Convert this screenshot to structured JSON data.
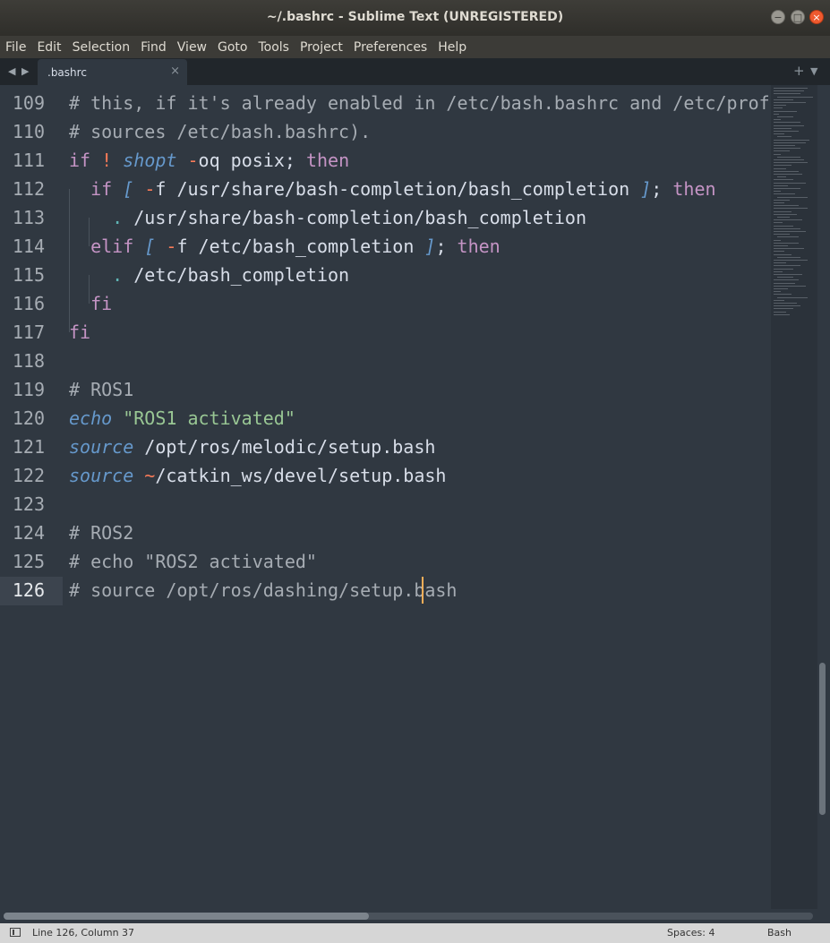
{
  "window": {
    "title": "~/.bashrc - Sublime Text (UNREGISTERED)",
    "buttons": {
      "minimize": "−",
      "maximize": "□",
      "close": "×"
    }
  },
  "menu": [
    "File",
    "Edit",
    "Selection",
    "Find",
    "View",
    "Goto",
    "Tools",
    "Project",
    "Preferences",
    "Help"
  ],
  "tabs": {
    "prev_icon": "◀",
    "next_icon": "▶",
    "active": {
      "label": ".bashrc",
      "close": "×"
    },
    "new_tab": "+",
    "tab_menu": "▼"
  },
  "editor": {
    "line_numbers": [
      "109",
      "110",
      "111",
      "112",
      "113",
      "114",
      "115",
      "116",
      "117",
      "118",
      "119",
      "120",
      "121",
      "122",
      "123",
      "124",
      "125",
      "126"
    ],
    "current_line": "126",
    "lines": [
      {
        "tokens": [
          {
            "t": "# this, if it's already enabled in /etc/bash.bashrc and /etc/profile",
            "c": "cm"
          }
        ]
      },
      {
        "tokens": [
          {
            "t": "# sources /etc/bash.bashrc).",
            "c": "cm"
          }
        ]
      },
      {
        "tokens": [
          {
            "t": "if",
            "c": "kw"
          },
          {
            "t": " ",
            "c": "pl"
          },
          {
            "t": "!",
            "c": "op"
          },
          {
            "t": " ",
            "c": "pl"
          },
          {
            "t": "shopt",
            "c": "fn"
          },
          {
            "t": " ",
            "c": "pl"
          },
          {
            "t": "-",
            "c": "op"
          },
          {
            "t": "oq posix; ",
            "c": "pl"
          },
          {
            "t": "then",
            "c": "kw"
          }
        ]
      },
      {
        "tokens": [
          {
            "t": "  ",
            "c": "pl"
          },
          {
            "t": "if",
            "c": "kw"
          },
          {
            "t": " ",
            "c": "pl"
          },
          {
            "t": "[",
            "c": "fn"
          },
          {
            "t": " ",
            "c": "pl"
          },
          {
            "t": "-",
            "c": "op"
          },
          {
            "t": "f /usr/share/bash-completion/bash_completion ",
            "c": "pl"
          },
          {
            "t": "]",
            "c": "fn"
          },
          {
            "t": "; ",
            "c": "pl"
          },
          {
            "t": "then",
            "c": "kw"
          }
        ]
      },
      {
        "tokens": [
          {
            "t": "    ",
            "c": "pl"
          },
          {
            "t": ".",
            "c": "br"
          },
          {
            "t": " /usr/share/bash-completion/bash_completion",
            "c": "pl"
          }
        ]
      },
      {
        "tokens": [
          {
            "t": "  ",
            "c": "pl"
          },
          {
            "t": "elif",
            "c": "kw"
          },
          {
            "t": " ",
            "c": "pl"
          },
          {
            "t": "[",
            "c": "fn"
          },
          {
            "t": " ",
            "c": "pl"
          },
          {
            "t": "-",
            "c": "op"
          },
          {
            "t": "f /etc/bash_completion ",
            "c": "pl"
          },
          {
            "t": "]",
            "c": "fn"
          },
          {
            "t": "; ",
            "c": "pl"
          },
          {
            "t": "then",
            "c": "kw"
          }
        ]
      },
      {
        "tokens": [
          {
            "t": "    ",
            "c": "pl"
          },
          {
            "t": ".",
            "c": "br"
          },
          {
            "t": " /etc/bash_completion",
            "c": "pl"
          }
        ]
      },
      {
        "tokens": [
          {
            "t": "  ",
            "c": "pl"
          },
          {
            "t": "fi",
            "c": "kw"
          }
        ]
      },
      {
        "tokens": [
          {
            "t": "fi",
            "c": "kw"
          }
        ]
      },
      {
        "tokens": []
      },
      {
        "tokens": [
          {
            "t": "# ROS1",
            "c": "cm"
          }
        ]
      },
      {
        "tokens": [
          {
            "t": "echo",
            "c": "fn"
          },
          {
            "t": " ",
            "c": "pl"
          },
          {
            "t": "\"ROS1 activated\"",
            "c": "st"
          }
        ]
      },
      {
        "tokens": [
          {
            "t": "source",
            "c": "fn"
          },
          {
            "t": " /opt/ros/melodic/setup.bash",
            "c": "pl"
          }
        ]
      },
      {
        "tokens": [
          {
            "t": "source",
            "c": "fn"
          },
          {
            "t": " ",
            "c": "pl"
          },
          {
            "t": "~",
            "c": "op"
          },
          {
            "t": "/catkin_ws/devel/setup.bash",
            "c": "pl"
          }
        ]
      },
      {
        "tokens": []
      },
      {
        "tokens": [
          {
            "t": "# ROS2",
            "c": "cm"
          }
        ]
      },
      {
        "tokens": [
          {
            "t": "# echo \"ROS2 activated\"",
            "c": "cm"
          }
        ]
      },
      {
        "tokens": [
          {
            "t": "# source /opt/ros/dashing/setup.bash",
            "c": "cm"
          }
        ]
      }
    ]
  },
  "status": {
    "position": "Line 126, Column 37",
    "spaces": "Spaces: 4",
    "syntax": "Bash"
  },
  "colors": {
    "background": "#303841",
    "comment": "#a6acb3",
    "keyword": "#c594c5",
    "function": "#6699cc",
    "string": "#99c794",
    "operator": "#f97b58",
    "caret": "#f9ae58"
  }
}
